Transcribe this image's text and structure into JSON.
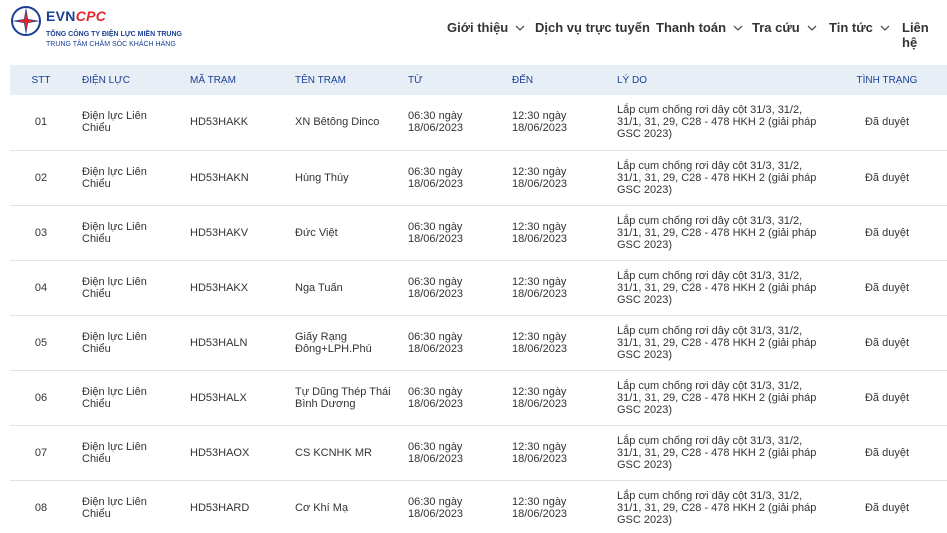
{
  "brand": {
    "evn": "EVN",
    "cpc": "CPC",
    "line1": "TỔNG CÔNG TY ĐIỆN LỰC MIỀN TRUNG",
    "line2": "TRUNG TÂM CHĂM SÓC KHÁCH HÀNG"
  },
  "nav": {
    "items": [
      {
        "label": "Giới thiệu",
        "has_dropdown": true
      },
      {
        "label": "Dịch vụ trực tuyến",
        "has_dropdown": false
      },
      {
        "label": "Thanh toán",
        "has_dropdown": true
      },
      {
        "label": "Tra cứu",
        "has_dropdown": true
      },
      {
        "label": "Tin tức",
        "has_dropdown": true
      },
      {
        "label": "Liên hệ",
        "has_dropdown": false
      }
    ]
  },
  "table": {
    "headers": {
      "stt": "STT",
      "dien_luc": "ĐIỆN LỰC",
      "ma_tram": "MÃ TRẠM",
      "ten_tram": "TÊN TRẠM",
      "tu": "TỪ",
      "den": "ĐẾN",
      "ly_do": "LÝ DO",
      "tinh_trang": "TÌNH TRẠNG"
    },
    "rows": [
      {
        "stt": "01",
        "dien_luc": "Điện lực Liên Chiểu",
        "ma_tram": "HD53HAKK",
        "ten_tram": "XN Bêtông Dinco",
        "tu": "06:30 ngày 18/06/2023",
        "den": "12:30 ngày 18/06/2023",
        "ly_do": "Lắp cụm chống rơi dây cột 31/3, 31/2, 31/1, 31, 29, C28 - 478 HKH 2 (giải pháp GSC 2023)",
        "tinh_trang": "Đã duyệt"
      },
      {
        "stt": "02",
        "dien_luc": "Điện lực Liên Chiểu",
        "ma_tram": "HD53HAKN",
        "ten_tram": "Hùng Thúy",
        "tu": "06:30 ngày 18/06/2023",
        "den": "12:30 ngày 18/06/2023",
        "ly_do": "Lắp cụm chống rơi dây cột 31/3, 31/2, 31/1, 31, 29, C28 - 478 HKH 2 (giải pháp GSC 2023)",
        "tinh_trang": "Đã duyệt"
      },
      {
        "stt": "03",
        "dien_luc": "Điện lực Liên Chiểu",
        "ma_tram": "HD53HAKV",
        "ten_tram": "Đức Việt",
        "tu": "06:30 ngày 18/06/2023",
        "den": "12:30 ngày 18/06/2023",
        "ly_do": "Lắp cụm chống rơi dây cột 31/3, 31/2, 31/1, 31, 29, C28 - 478 HKH 2 (giải pháp GSC 2023)",
        "tinh_trang": "Đã duyệt"
      },
      {
        "stt": "04",
        "dien_luc": "Điện lực Liên Chiểu",
        "ma_tram": "HD53HAKX",
        "ten_tram": "Nga Tuấn",
        "tu": "06:30 ngày 18/06/2023",
        "den": "12:30 ngày 18/06/2023",
        "ly_do": "Lắp cụm chống rơi dây cột 31/3, 31/2, 31/1, 31, 29, C28 - 478 HKH 2 (giải pháp GSC 2023)",
        "tinh_trang": "Đã duyệt"
      },
      {
        "stt": "05",
        "dien_luc": "Điện lực Liên Chiểu",
        "ma_tram": "HD53HALN",
        "ten_tram": "Giấy Rạng Đông+LPH.Phú",
        "tu": "06:30 ngày 18/06/2023",
        "den": "12:30 ngày 18/06/2023",
        "ly_do": "Lắp cụm chống rơi dây cột 31/3, 31/2, 31/1, 31, 29, C28 - 478 HKH 2 (giải pháp GSC 2023)",
        "tinh_trang": "Đã duyệt"
      },
      {
        "stt": "06",
        "dien_luc": "Điện lực Liên Chiểu",
        "ma_tram": "HD53HALX",
        "ten_tram": "Tự Dũng Thép Thái Bình Dương",
        "tu": "06:30 ngày 18/06/2023",
        "den": "12:30 ngày 18/06/2023",
        "ly_do": "Lắp cụm chống rơi dây cột 31/3, 31/2, 31/1, 31, 29, C28 - 478 HKH 2 (giải pháp GSC 2023)",
        "tinh_trang": "Đã duyệt"
      },
      {
        "stt": "07",
        "dien_luc": "Điện lực Liên Chiểu",
        "ma_tram": "HD53HAOX",
        "ten_tram": "CS KCNHK MR",
        "tu": "06:30 ngày 18/06/2023",
        "den": "12:30 ngày 18/06/2023",
        "ly_do": "Lắp cụm chống rơi dây cột 31/3, 31/2, 31/1, 31, 29, C28 - 478 HKH 2 (giải pháp GSC 2023)",
        "tinh_trang": "Đã duyệt"
      },
      {
        "stt": "08",
        "dien_luc": "Điện lực Liên Chiểu",
        "ma_tram": "HD53HARD",
        "ten_tram": "Cơ Khí Mạ",
        "tu": "06:30 ngày 18/06/2023",
        "den": "12:30 ngày 18/06/2023",
        "ly_do": "Lắp cụm chống rơi dây cột 31/3, 31/2, 31/1, 31, 29, C28 - 478 HKH 2 (giải pháp GSC 2023)",
        "tinh_trang": "Đã duyệt"
      }
    ]
  },
  "icons": {
    "logo": "evn-logo-icon",
    "dropdown": "chevron-down-icon"
  },
  "colors": {
    "brand_blue": "#1a3f95",
    "brand_red": "#e3262a",
    "header_row_bg": "#e8eef6"
  }
}
